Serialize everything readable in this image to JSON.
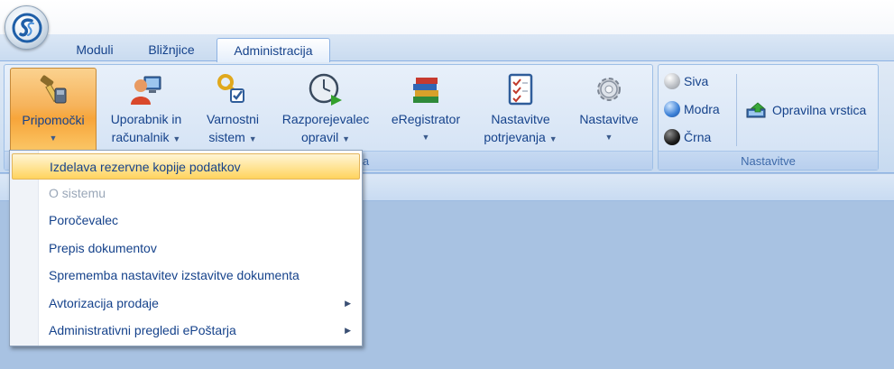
{
  "tabs": [
    {
      "label": "Moduli"
    },
    {
      "label": "Bližnjice"
    },
    {
      "label": "Administracija"
    }
  ],
  "ribbon": {
    "buttons": [
      {
        "line1": "Pripomočki",
        "line2": "",
        "icon": "tools-icon"
      },
      {
        "line1": "Uporabnik in",
        "line2": "računalnik",
        "icon": "user-computer-icon"
      },
      {
        "line1": "Varnostni",
        "line2": "sistem",
        "icon": "security-keys-icon"
      },
      {
        "line1": "Razporejevalec",
        "line2": "opravil",
        "icon": "scheduler-clock-icon"
      },
      {
        "line1": "eRegistrator",
        "line2": "",
        "icon": "books-icon"
      },
      {
        "line1": "Nastavitve",
        "line2": "potrjevanja",
        "icon": "checklist-icon"
      },
      {
        "line1": "Nastavitve",
        "line2": "",
        "icon": "gear-icon"
      }
    ],
    "group_partial_label": "ja",
    "settings_group": {
      "label": "Nastavitve",
      "themes": [
        {
          "label": "Siva",
          "color": "#b8bcc2"
        },
        {
          "label": "Modra",
          "color": "#3a7fd6"
        },
        {
          "label": "Črna",
          "color": "#1c1c1c"
        }
      ],
      "taskbar_label": "Opravilna vrstica"
    }
  },
  "menu": {
    "items": [
      {
        "label": "Izdelava rezervne kopije podatkov",
        "state": "highlighted"
      },
      {
        "label": "O sistemu",
        "state": "disabled"
      },
      {
        "label": "Poročevalec",
        "state": "normal"
      },
      {
        "label": "Prepis dokumentov",
        "state": "normal"
      },
      {
        "label": "Sprememba nastavitev izstavitve dokumenta",
        "state": "normal"
      },
      {
        "label": "Avtorizacija prodaje",
        "state": "submenu"
      },
      {
        "label": "Administrativni pregledi ePoštarja",
        "state": "submenu"
      }
    ],
    "submenu_arrow": "▶"
  },
  "colors": {
    "ribbon_text": "#15428b",
    "pressed_orange": "#f7a53a",
    "menu_highlight": "#ffd35e"
  }
}
